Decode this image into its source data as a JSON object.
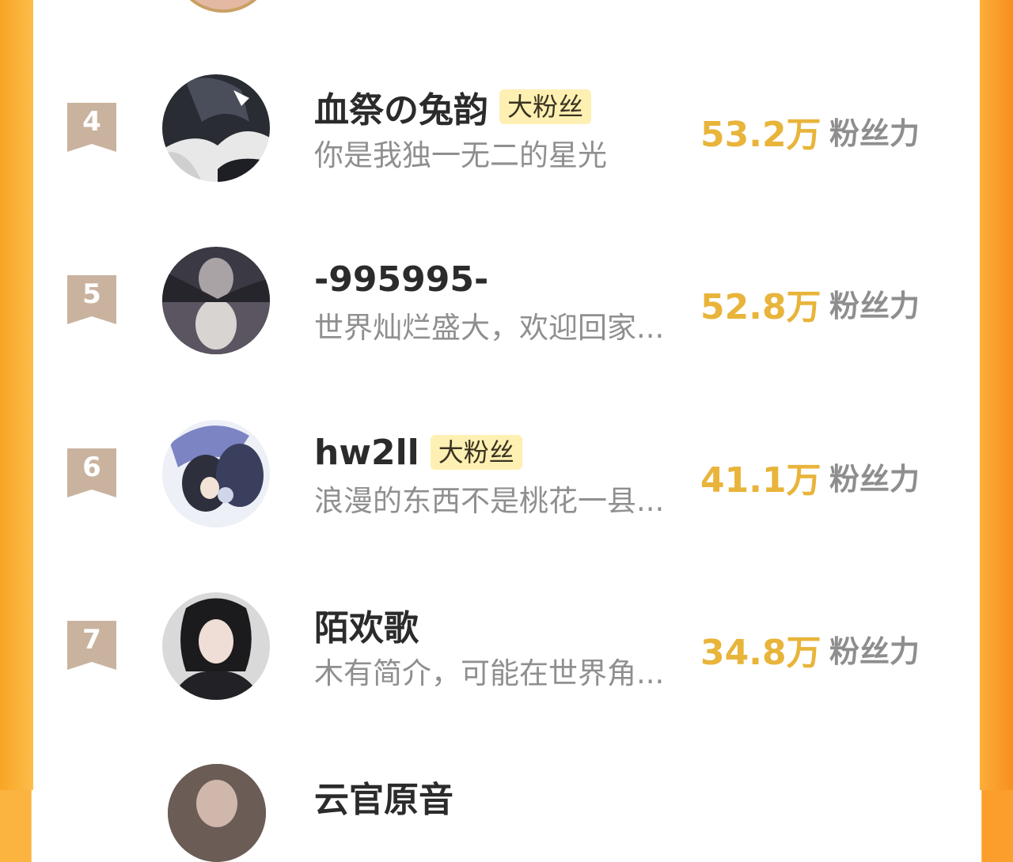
{
  "ranking": [
    {
      "rank": "4",
      "name": "血祭の兔韵",
      "tag": "大粉丝",
      "intro": "你是我独一无二的星光",
      "score": "53.2万",
      "score_label": "粉丝力",
      "avatar": "dark-haired-anime-figure-avatar"
    },
    {
      "rank": "5",
      "name": "-995995-",
      "tag": "",
      "intro": "世界灿烂盛大，欢迎回家...",
      "score": "52.8万",
      "score_label": "粉丝力",
      "avatar": "cat-tiger-reflection-avatar"
    },
    {
      "rank": "6",
      "name": "hw2ll",
      "tag": "大粉丝",
      "intro": "浪漫的东西不是桃花一县...",
      "score": "41.1万",
      "score_label": "粉丝力",
      "avatar": "anime-couple-avatar"
    },
    {
      "rank": "7",
      "name": "陌欢歌",
      "tag": "",
      "intro": "木有简介，可能在世界角...",
      "score": "34.8万",
      "score_label": "粉丝力",
      "avatar": "black-haired-man-avatar"
    }
  ],
  "partial_next_name": "云官原音",
  "colors": {
    "frame_orange": "#fbb43f",
    "score_gold": "#e8b43a",
    "tag_bg": "#fdf0b2",
    "rank_badge": "#c9b39f"
  }
}
